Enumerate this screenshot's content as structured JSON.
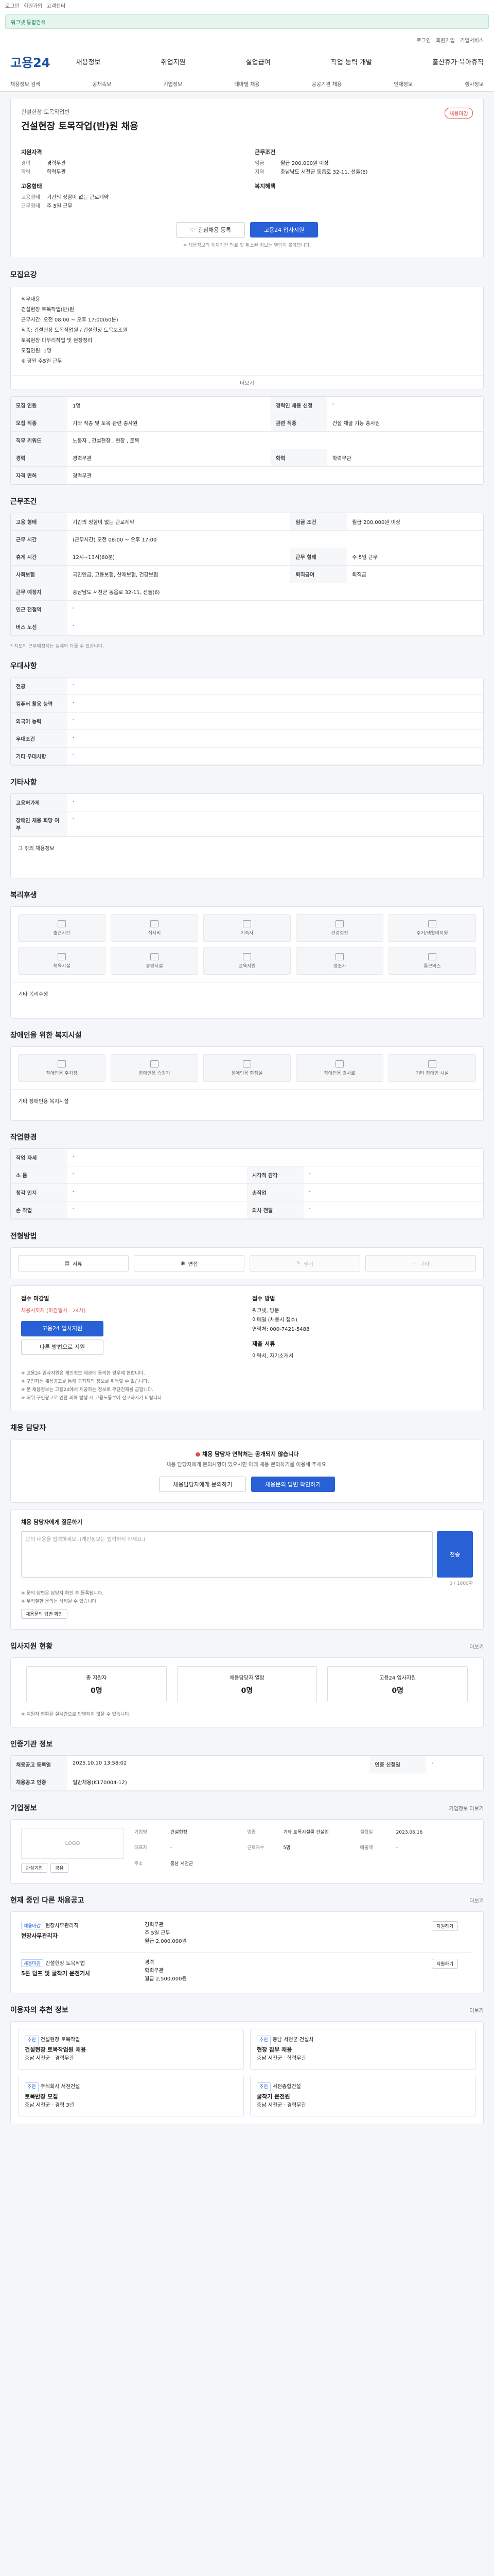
{
  "topbar": {
    "links": [
      "로그인",
      "회원가입",
      "고객센터"
    ]
  },
  "search_banner": {
    "text": "워크넷 통합검색"
  },
  "util": {
    "items": [
      "로그인",
      "회원가입",
      "기업서비스"
    ]
  },
  "gnb": {
    "logo": "고용24",
    "menu": [
      "채용정보",
      "취업지원",
      "실업급여",
      "직업 능력 개발",
      "출산휴가·육아휴직"
    ]
  },
  "subtabs": [
    "채용정보 검색",
    "공채속보",
    "기업정보",
    "테마별 채용",
    "공공기관 채용",
    "인재정보",
    "행사정보"
  ],
  "header": {
    "company": "건설현장 토목작업반",
    "title": "건설현장 토목작업(반)원 채용",
    "badge": "채용마감",
    "left_heading": "지원자격",
    "left_rows": [
      {
        "k": "경력",
        "v": "경력무관"
      },
      {
        "k": "학력",
        "v": "학력무관"
      }
    ],
    "left_heading2": "고용형태",
    "left_rows2": [
      {
        "k": "고용형태",
        "v": "기간의 정함이 없는 근로계약"
      },
      {
        "k": "근무형태",
        "v": "주 5일 근무"
      }
    ],
    "right_heading": "근무조건",
    "right_rows": [
      {
        "k": "임금",
        "v": "월급 200,000원 이상"
      },
      {
        "k": "지역",
        "v": "충남남도 서천군 동읍로 32-11, 선돌(6)"
      }
    ],
    "right_heading2": "복지혜택",
    "scrap_label": "관심채용 등록",
    "apply_label": "고용24 입사지원",
    "note": "※ 채용정보의 게재기간 만료 및 취소된 정보는 열람이 불가합니다."
  },
  "recruit_sec": {
    "title": "모집요강",
    "lines": [
      "직무내용",
      "건설현장 토목작업(반)원",
      "근무시간: 오전 08:00 ~ 오후 17:00(60분)",
      "직종: 건설현장 토목작업원 / 건설현장 토목보조원",
      "토목현장 마무리작업 및 현장정리",
      "모집인원: 1명",
      "※ 평일 주5일 근무"
    ],
    "more": "더보기"
  },
  "recruit_table": [
    {
      "k": "모집 인원",
      "v": "1명",
      "k2": "경력인 채용 신청",
      "v2": "-"
    },
    {
      "k": "모집 직종",
      "v": "기타 직종 및 토목 관련 종사원",
      "k2": "관련 직종",
      "v2": "건설 채굴 기능 종사원"
    },
    {
      "k": "직무 키워드",
      "v": "노동자 , 건설현장 , 현장 , 토목",
      "k2": "",
      "v2": ""
    },
    {
      "k": "경력",
      "v": "경력무관",
      "k2": "학력",
      "v2": "학력무관"
    },
    {
      "k": "자격 면허",
      "v": "경력무관",
      "k2": "",
      "v2": ""
    }
  ],
  "work_sec": {
    "title": "근무조건"
  },
  "work_table": [
    {
      "k": "고용 형태",
      "v": "기간의 정함이 없는 근로계약",
      "k2": "임금 조건",
      "v2": "월급 200,000원 이상"
    },
    {
      "k": "근무 시간",
      "v": "(근무시간) 오전 08:00 ~ 오후 17:00",
      "k2": "",
      "v2": ""
    },
    {
      "k": "휴게 시간",
      "v": "12시~13시(60분)",
      "k2": "근무 형태",
      "v2": "주 5일 근무"
    },
    {
      "k": "사회보험",
      "v": "국민연금, 고용보험, 산재보험, 건강보험",
      "k2": "퇴직급여",
      "v2": "퇴직금"
    },
    {
      "k": "근무 예정지",
      "v": "충남남도 서천군 동읍로 32-11, 선돌(6)",
      "k2": "",
      "v2": ""
    },
    {
      "k": "인근 전철역",
      "v": "-",
      "k2": "",
      "v2": ""
    },
    {
      "k": "버스 노선",
      "v": "-",
      "k2": "",
      "v2": ""
    }
  ],
  "work_note": "* 지도의 근무예정지는 실제와 다를 수 있습니다.",
  "prefer_sec": {
    "title": "우대사항"
  },
  "prefer_table": [
    {
      "k": "전공",
      "v": "-"
    },
    {
      "k": "컴퓨터 활용 능력",
      "v": "-"
    },
    {
      "k": "외국어 능력",
      "v": "-"
    },
    {
      "k": "우대조건",
      "v": "-"
    },
    {
      "k": "기타 우대사항",
      "v": "-"
    }
  ],
  "other_sec": {
    "title": "기타사항"
  },
  "other_table": [
    {
      "k": "고용허가제",
      "v": "-"
    },
    {
      "k": "장애인 채용 희망 여부",
      "v": "-"
    }
  ],
  "other_extra": "그 밖의 채용정보",
  "welfare": {
    "title": "복리후생",
    "items": [
      "출근시간",
      "식사비",
      "기숙사",
      "건강검진",
      "주거/생활비지원",
      "체육시설",
      "휴양시설",
      "교육지원",
      "경조사",
      "통근버스"
    ],
    "extra": "기타 복리후생"
  },
  "disabled": {
    "title": "장애인을 위한 복지시설",
    "items": [
      "장애인용 주차장",
      "장애인용 승강기",
      "장애인용 화장실",
      "장애인용 경사로",
      "기타 장애인 시설"
    ],
    "extra": "기타 장애인용 복지시설"
  },
  "env": {
    "title": "작업환경",
    "rows": [
      {
        "k": "작업 자세",
        "v": "-",
        "k2": "",
        "v2": ""
      },
      {
        "k": "소 음",
        "v": "-",
        "k2": "시각적 감각",
        "v2": "-"
      },
      {
        "k": "청각 인지",
        "v": "-",
        "k2": "손작업",
        "v2": "-"
      },
      {
        "k": "손 작업",
        "v": "-",
        "k2": "의사 전달",
        "v2": "-"
      }
    ]
  },
  "method": {
    "title": "전형방법",
    "items": [
      {
        "l": "서류",
        "on": true
      },
      {
        "l": "면접",
        "on": true
      },
      {
        "l": "필기",
        "on": false
      },
      {
        "l": "기타",
        "on": false
      }
    ]
  },
  "apply": {
    "left_title": "접수 마감일",
    "left_date": "채용시까지 (마감일시 : 24시)",
    "apply_btn": "고용24 입사지원",
    "other_btn": "다른 방법으로 지원",
    "right_title": "접수 방법",
    "right_lines": [
      "워크넷, 방문",
      "이메일 (채용시 접수)",
      "연락처: 000-7421-5488"
    ],
    "docs_title": "제출 서류",
    "docs": "이력서, 자기소개서",
    "bullets": [
      "※ 고용24 입사지원은 개인정보 제공에 동의한 경우에 한합니다.",
      "※ 구인자는 채용공고를 통해 구직자의 정보를 취득할 수 없습니다.",
      "※ 본 채용정보는 고용24에서 제공하는 정보로 무단전재를 금합니다.",
      "※ 허위 구인광고로 인한 피해 발생 시 고용노동부에 신고하시기 바랍니다."
    ]
  },
  "contact": {
    "title": "채용 담당자",
    "warn": "채용 담당자 연락처는 공개되지 않습니다",
    "sub": "채용 담당자에게 문의사항이 있으시면 아래 채용 문의하기를 이용해 주세요.",
    "btn1": "채용담당자에게 문의하기",
    "btn2": "채용문의 답변 확인하기"
  },
  "inquiry": {
    "title": "채용 담당자에게 질문하기",
    "placeholder": "문의 내용을 입력하세요. (개인정보는 입력하지 마세요.)",
    "btn": "전송",
    "count": "0 / 1000자",
    "bullets": [
      "※ 문의 답변은 담당자 확인 후 등록됩니다.",
      "※ 부적절한 문의는 삭제될 수 있습니다."
    ],
    "inquiry_link": "채용문의 답변 확인"
  },
  "stats": {
    "title": "입사지원 현황",
    "more": "더보기",
    "items": [
      {
        "l": "총 지원자",
        "v": "0명"
      },
      {
        "l": "채용담당자 열람",
        "v": "0명"
      },
      {
        "l": "고용24 입사지원",
        "v": "0명"
      }
    ],
    "note": "※ 지원자 현황은 실시간으로 반영되지 않을 수 있습니다."
  },
  "info_period": {
    "title": "인증기관 정보",
    "rows": [
      {
        "k": "채용공고 등록일",
        "v": "2025.10.10 13:58:02",
        "k2": "인증 신청일",
        "v2": "-"
      },
      {
        "k": "채용공고 인증",
        "v": "일반채용(K170004-12)",
        "k2": "",
        "v2": ""
      }
    ]
  },
  "company": {
    "title": "기업정보",
    "more": "기업정보 더보기",
    "logo": "LOGO",
    "btn_scrap": "관심기업",
    "btn_share": "공유",
    "rows": [
      {
        "k": "기업명",
        "v": "건설현장",
        "k2": "업종",
        "v2": "기타 토목시설물 건설업",
        "k3": "설립일",
        "v3": "2023.06.16"
      },
      {
        "k": "대표자",
        "v": "-",
        "k2": "근로자수",
        "v2": "5명",
        "k3": "매출액",
        "v3": "-"
      },
      {
        "k": "주소",
        "v": "충남 서천군",
        "k2": "",
        "v2": "",
        "k3": "",
        "v3": ""
      }
    ]
  },
  "other_jobs": {
    "title": "현재 중인 다른 채용공고",
    "more": "더보기",
    "items": [
      {
        "tag": "채용마감",
        "company": "현장사무관리직",
        "title": "현장사무관리자",
        "cond": [
          "경력무관",
          "주 5일 근무",
          "월급 2,000,000원"
        ],
        "btn": "지원하기"
      },
      {
        "tag": "채용마감",
        "company": "건설현장 토목작업",
        "title": "5톤 덤프 및 굴착기 운전기사",
        "cond": [
          "경력",
          "학력무관",
          "월급 2,500,000원"
        ],
        "btn": "지원하기"
      }
    ]
  },
  "recommend": {
    "title": "이용자의 추천 정보",
    "more": "더보기",
    "items": [
      {
        "tag": "추천",
        "company": "건설현장 토목작업",
        "title": "건설현장 토목작업원 채용",
        "cond": "충남 서천군 · 경력무관"
      },
      {
        "tag": "추천",
        "company": "충남 서천군 건설사",
        "title": "현장 잡부 채용",
        "cond": "충남 서천군 · 학력무관"
      },
      {
        "tag": "추천",
        "company": "주식회사 서천건설",
        "title": "토목반장 모집",
        "cond": "충남 서천군 · 경력 3년"
      },
      {
        "tag": "추천",
        "company": "서천종합건설",
        "title": "굴착기 운전원",
        "cond": "충남 서천군 · 경력무관"
      }
    ]
  },
  "colors": {
    "primary": "#2860d6",
    "logo": "#1e50a2",
    "warn": "#e04b4b"
  }
}
